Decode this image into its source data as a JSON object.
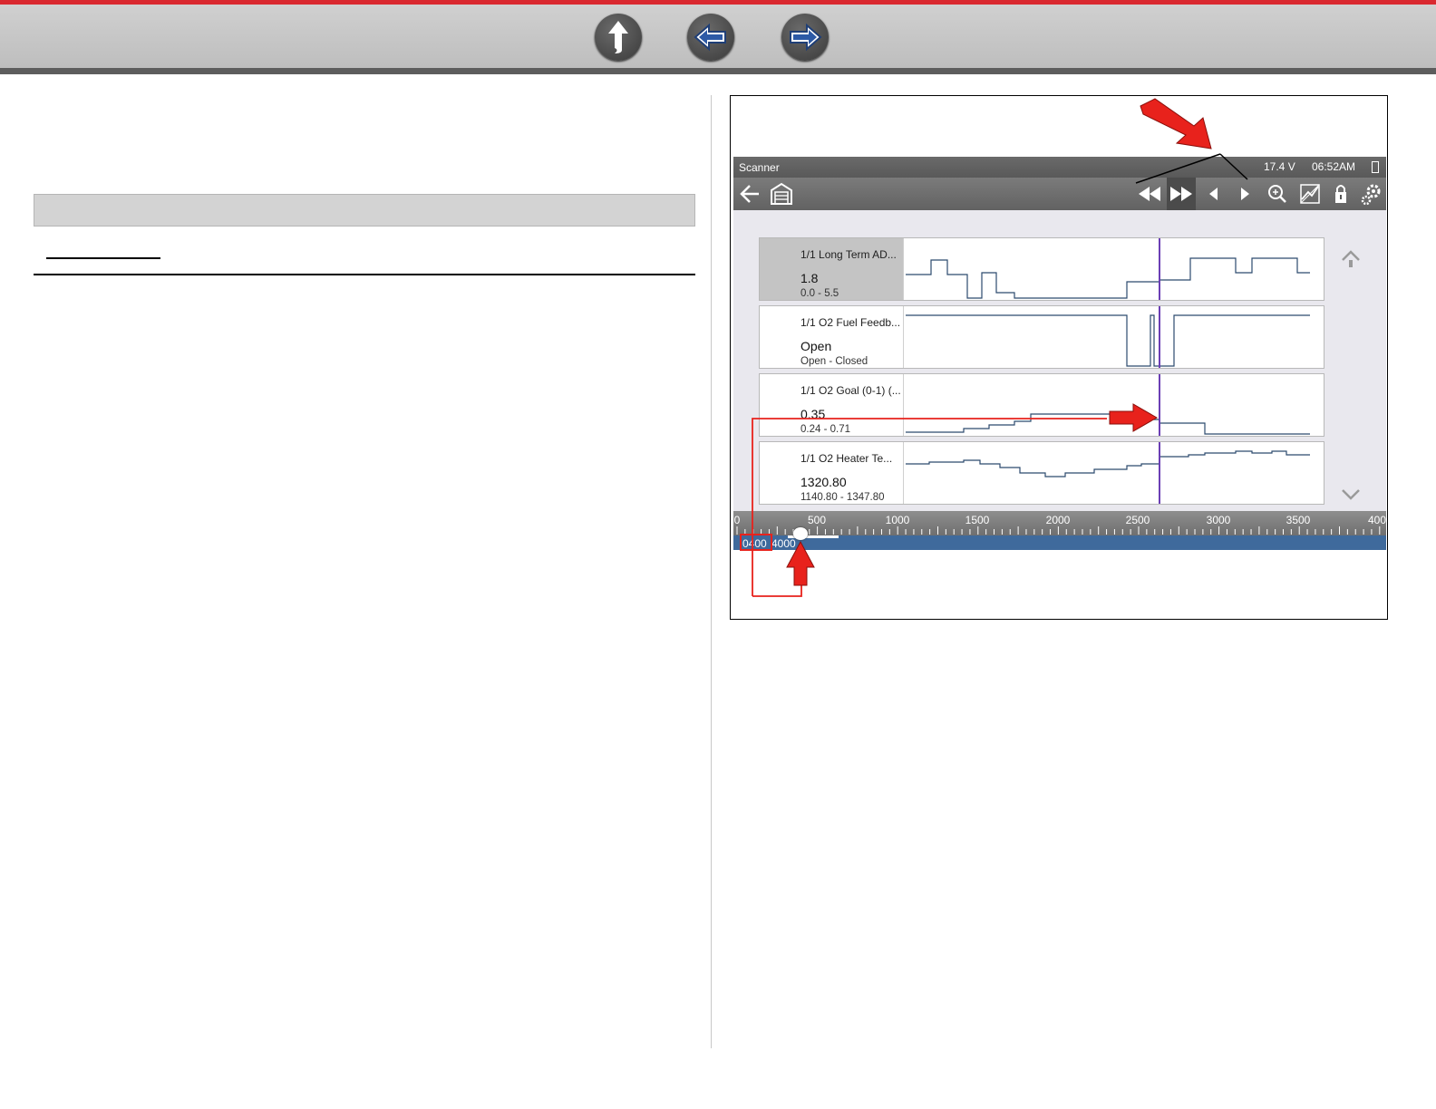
{
  "nav": {
    "buttons": [
      {
        "name": "up",
        "icon": "up-arrow-icon"
      },
      {
        "name": "back",
        "icon": "left-arrow-icon"
      },
      {
        "name": "forward",
        "icon": "right-arrow-icon"
      }
    ],
    "accent_color": "#d9282f"
  },
  "screen": {
    "status": {
      "title": "Scanner",
      "voltage": "17.4 V",
      "time": "06:52AM"
    },
    "toolbar": {
      "icons": [
        "back-arrow-icon",
        "garage-home-icon",
        "rewind-icon",
        "fast-forward-icon",
        "step-back-icon",
        "step-forward-icon",
        "zoom-icon",
        "graph-settings-icon",
        "lock-icon",
        "settings-gear-icon"
      ]
    },
    "rows": [
      {
        "name": "1/1 Long Term AD...",
        "value": "1.8",
        "range": "0.0 - 5.5",
        "selected": true
      },
      {
        "name": "1/1 O2 Fuel Feedb...",
        "value": "Open",
        "range": "Open - Closed",
        "selected": false
      },
      {
        "name": "1/1 O2 Goal (0-1) (...",
        "value": "0.35",
        "range": "0.24 - 0.71",
        "selected": false
      },
      {
        "name": "1/1 O2 Heater Te...",
        "value": "1320.80",
        "range": "1140.80 - 1347.80",
        "selected": false
      }
    ],
    "ruler": {
      "labels": [
        "0",
        "500",
        "1000",
        "1500",
        "2000",
        "2500",
        "3000",
        "3500",
        "400"
      ]
    },
    "position": {
      "start": "0400",
      "end": "4000"
    }
  }
}
